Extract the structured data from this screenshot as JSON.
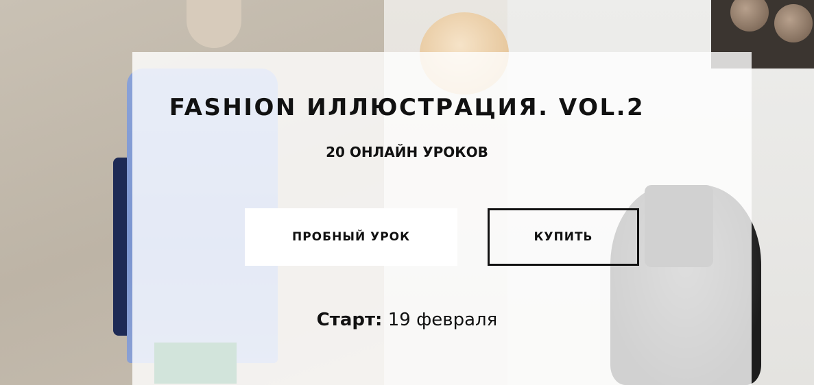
{
  "course": {
    "title": "FASHION ИЛЛЮСТРАЦИЯ. VOL.2",
    "subtitle": "20 ОНЛАЙН УРОКОВ"
  },
  "buttons": {
    "trial_label": "ПРОБНЫЙ УРОК",
    "buy_label": "КУПИТЬ"
  },
  "start": {
    "label": "Старт:",
    "date": "19 февраля"
  },
  "colors": {
    "text": "#111111",
    "card_background": "#ffffff"
  }
}
